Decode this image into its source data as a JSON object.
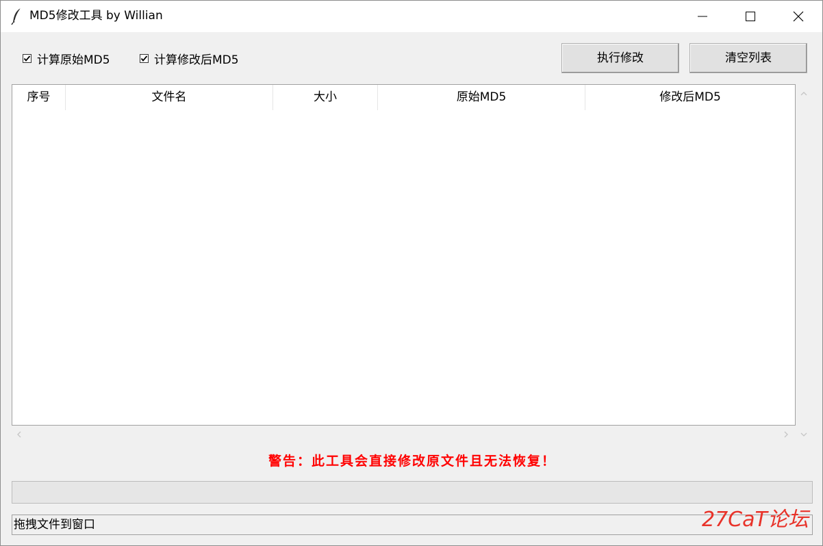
{
  "window": {
    "title": "MD5修改工具 by Willian",
    "icon": "feather-icon",
    "controls": [
      "minimize-icon",
      "maximize-icon",
      "close-icon"
    ]
  },
  "options": {
    "calc_original_label": "计算原始MD5",
    "calc_original_checked": true,
    "calc_modified_label": "计算修改后MD5",
    "calc_modified_checked": true
  },
  "toolbar": {
    "execute_label": "执行修改",
    "clear_label": "清空列表"
  },
  "table": {
    "columns": [
      "序号",
      "文件名",
      "大小",
      "原始MD5",
      "修改后MD5"
    ],
    "rows": []
  },
  "warning": {
    "text": "警告：此工具会直接修改原文件且无法恢复！",
    "color": "#ff0000"
  },
  "progress": {
    "value": 0
  },
  "status": {
    "text": "拖拽文件到窗口"
  },
  "watermark": {
    "text": "27CaT论坛",
    "color": "#e8332a"
  }
}
